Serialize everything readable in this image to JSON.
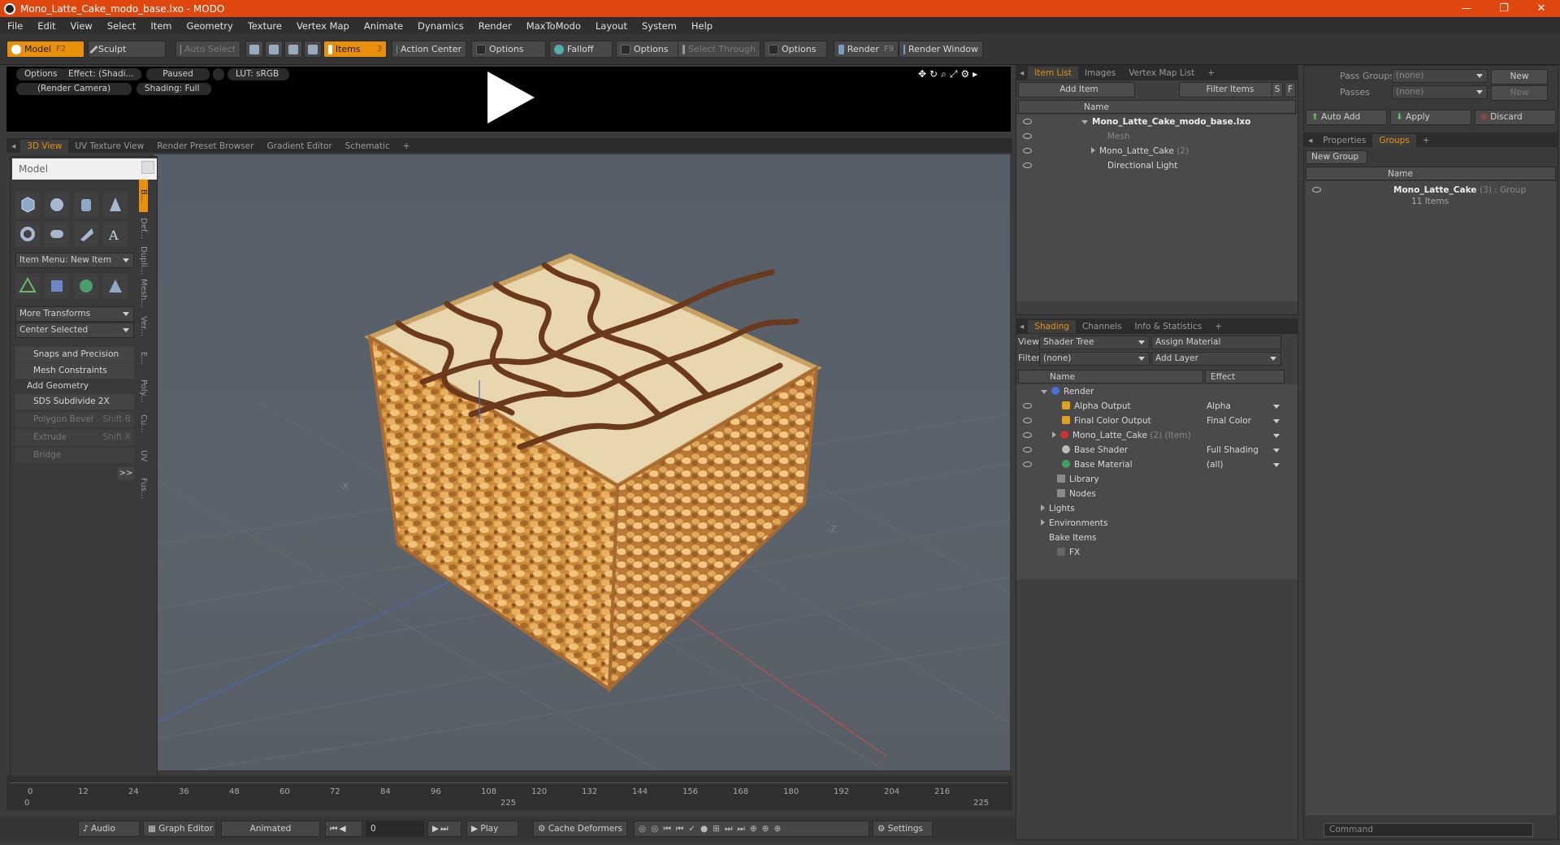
{
  "window": {
    "title": "Mono_Latte_Cake_modo_base.lxo - MODO",
    "min": "—",
    "max": "❐",
    "close": "✕"
  },
  "menu": [
    "File",
    "Edit",
    "View",
    "Select",
    "Item",
    "Geometry",
    "Texture",
    "Vertex Map",
    "Animate",
    "Dynamics",
    "Render",
    "MaxToModo",
    "Layout",
    "System",
    "Help"
  ],
  "toolbar": {
    "model": "Model",
    "model_key": "F2",
    "sculpt": "Sculpt",
    "auto_select": "Auto Select",
    "items": "Items",
    "items_key": "3",
    "action_center": "Action Center",
    "options1": "Options",
    "falloff": "Falloff",
    "options2": "Options",
    "select_through": "Select Through",
    "options3": "Options",
    "render": "Render",
    "render_key": "F9",
    "render_window": "Render Window"
  },
  "preview": {
    "options": "Options",
    "effect": "Effect: (Shadi...",
    "paused": "Paused",
    "lut": "LUT: sRGB",
    "camera": "(Render Camera)",
    "shading": "Shading: Full"
  },
  "view_tabs": [
    "3D View",
    "UV Texture View",
    "Render Preset Browser",
    "Gradient Editor",
    "Schematic",
    "+"
  ],
  "left_panel": {
    "title": "Model",
    "item_menu": "Item Menu: New Item",
    "more_transforms": "More Transforms",
    "center_selected": "Center Selected",
    "snaps": "Snaps and Precision",
    "mesh_constraints": "Mesh Constraints",
    "add_geometry": "Add Geometry",
    "sds": "SDS Subdivide 2X",
    "polygon_bevel": "Polygon Bevel",
    "polygon_bevel_key": "Shift-B",
    "extrude": "Extrude",
    "extrude_key": "Shift-X",
    "bridge": "Bridge",
    "more": ">>",
    "vertical_tabs": [
      "B...",
      "Def...",
      "Dupli...",
      "Mesh...",
      "Ver...",
      "E...",
      "Poly...",
      "Cu...",
      "UV",
      "Fus..."
    ]
  },
  "viewport_axes": {
    "neg_x": "-X",
    "neg_z": "-Z"
  },
  "timeline": {
    "ticks": [
      "0",
      "12",
      "24",
      "36",
      "48",
      "60",
      "72",
      "84",
      "96",
      "108",
      "120",
      "132",
      "144",
      "156",
      "168",
      "180",
      "192",
      "204",
      "216"
    ],
    "start": "0",
    "mid": "225",
    "end": "225"
  },
  "bottombar": {
    "audio": "Audio",
    "graph_editor": "Graph Editor",
    "animated": "Animated",
    "frame": "0",
    "play": "Play",
    "cache": "Cache Deformers",
    "settings": "Settings"
  },
  "item_list": {
    "tabs": [
      "Item List",
      "Images",
      "Vertex Map List",
      "+"
    ],
    "add_item": "Add Item",
    "filter": "Filter Items",
    "s": "S",
    "f": "F",
    "col_name": "Name",
    "rows": [
      {
        "label": "Mono_Latte_Cake_modo_base.lxo",
        "extra": ""
      },
      {
        "label": "Mesh",
        "extra": ""
      },
      {
        "label": "Mono_Latte_Cake",
        "extra": "(2)"
      },
      {
        "label": "Directional Light",
        "extra": ""
      }
    ]
  },
  "shading": {
    "tabs": [
      "Shading",
      "Channels",
      "Info & Statistics",
      "+"
    ],
    "view_label": "View",
    "view_value": "Shader Tree",
    "assign": "Assign Material",
    "filter_label": "Filter",
    "filter_value": "(none)",
    "add_layer": "Add Layer",
    "col_name": "Name",
    "col_effect": "Effect",
    "rows": [
      {
        "label": "Render",
        "extra": "",
        "effect": "",
        "color": "#4a6fd8"
      },
      {
        "label": "Alpha Output",
        "extra": "",
        "effect": "Alpha",
        "color": "#e0a020"
      },
      {
        "label": "Final Color Output",
        "extra": "",
        "effect": "Final Color",
        "color": "#e0a020"
      },
      {
        "label": "Mono_Latte_Cake",
        "extra": "(2) (Item)",
        "effect": "",
        "color": "#d03030"
      },
      {
        "label": "Base Shader",
        "extra": "",
        "effect": "Full Shading",
        "color": "#bbbbbb"
      },
      {
        "label": "Base Material",
        "extra": "",
        "effect": "(all)",
        "color": "#40a060"
      },
      {
        "label": "Library",
        "extra": "",
        "effect": "",
        "color": ""
      },
      {
        "label": "Nodes",
        "extra": "",
        "effect": "",
        "color": ""
      },
      {
        "label": "Lights",
        "extra": "",
        "effect": "",
        "color": ""
      },
      {
        "label": "Environments",
        "extra": "",
        "effect": "",
        "color": ""
      },
      {
        "label": "Bake Items",
        "extra": "",
        "effect": "",
        "color": ""
      },
      {
        "label": "FX",
        "extra": "",
        "effect": "",
        "color": ""
      }
    ]
  },
  "groups_panel": {
    "pass_groups": "Pass Groups",
    "pass_groups_value": "(none)",
    "new": "New",
    "passes": "Passes",
    "passes_value": "(none)",
    "new2": "New",
    "auto_add": "Auto Add",
    "apply": "Apply",
    "discard": "Discard",
    "tabs": [
      "Properties",
      "Groups",
      "+"
    ],
    "new_group": "New Group",
    "col_name": "Name",
    "group_name": "Mono_Latte_Cake",
    "group_extra": "(3) : Group",
    "group_items": "11 Items",
    "command": "Command"
  },
  "colors": {
    "accent": "#e8900c",
    "title_bar": "#e0470f"
  }
}
